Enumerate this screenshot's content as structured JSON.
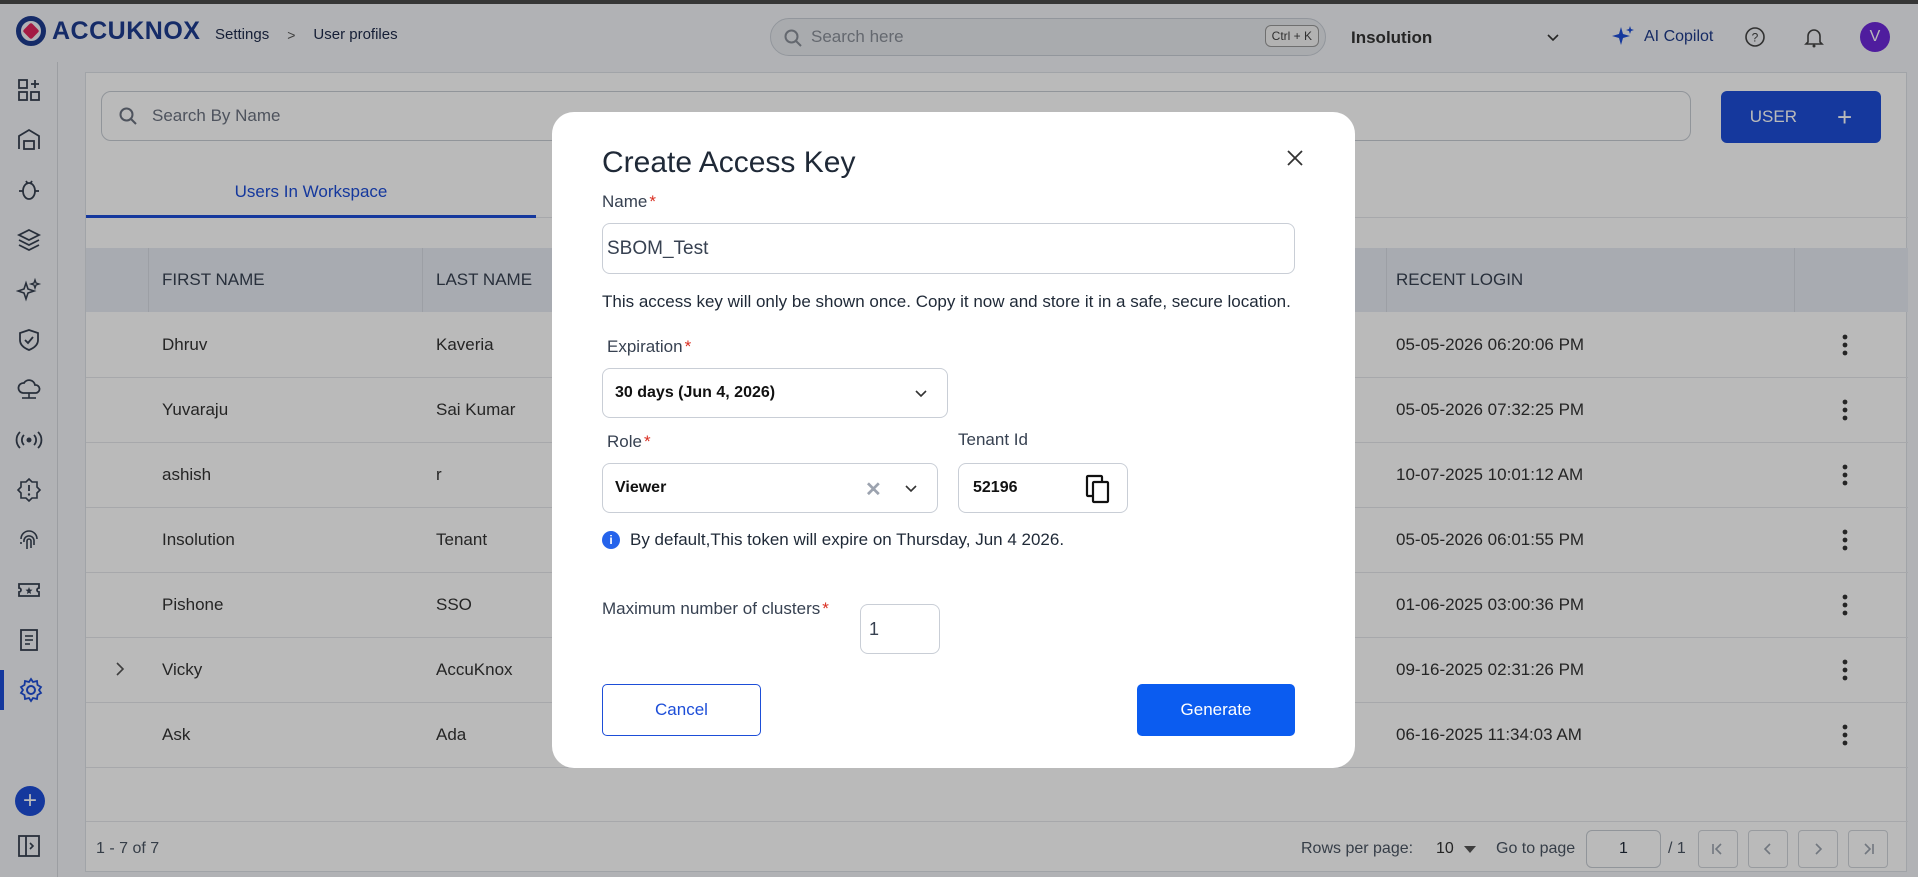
{
  "header": {
    "logo_text": "ACCUKNOX",
    "breadcrumb": [
      "Settings",
      "User profiles"
    ],
    "search_placeholder": "Search here",
    "search_shortcut": "Ctrl + K",
    "tenant": "Insolution",
    "copilot_label": "AI Copilot",
    "avatar_initial": "V"
  },
  "sidebar": {
    "icons": [
      "dashboard-icon",
      "inventory-icon",
      "bug-icon",
      "layers-icon",
      "sparkle-icon",
      "shield-icon",
      "cloud-network-icon",
      "radio-signal-icon",
      "alert-badge-icon",
      "fingerprint-icon",
      "ticket-icon",
      "report-icon",
      "settings-icon"
    ],
    "active": "settings-icon"
  },
  "main": {
    "search_placeholder": "Search By Name",
    "user_button": "USER",
    "tab_label": "Users In Workspace",
    "columns": [
      "FIRST NAME",
      "LAST NAME",
      "RECENT LOGIN"
    ],
    "rows": [
      {
        "first": "Dhruv",
        "last": "Kaveria",
        "login": "05-05-2026 06:20:06 PM"
      },
      {
        "first": "Yuvaraju",
        "last": "Sai Kumar",
        "login": "05-05-2026 07:32:25 PM"
      },
      {
        "first": "ashish",
        "last": "r",
        "login": "10-07-2025 10:01:12 AM"
      },
      {
        "first": "Insolution",
        "last": "Tenant",
        "login": "05-05-2026 06:01:55 PM"
      },
      {
        "first": "Pishone",
        "last": "SSO",
        "login": "01-06-2025 03:00:36 PM"
      },
      {
        "first": "Vicky",
        "last": "AccuKnox",
        "login": "09-16-2025 02:31:26 PM"
      },
      {
        "first": "Ask",
        "last": "Ada",
        "login": "06-16-2025 11:34:03 AM"
      }
    ],
    "footer": {
      "range": "1 - 7 of 7",
      "rows_per_page_label": "Rows per page:",
      "rows_per_page": "10",
      "go_to_page_label": "Go to page",
      "page": "1",
      "total_pages": "/ 1"
    }
  },
  "modal": {
    "title": "Create Access Key",
    "name_label": "Name",
    "name_value": "SBOM_Test",
    "notice": "This access key will only be shown once. Copy it now and store it in a safe, secure location.",
    "expiration_label": "Expiration",
    "expiration_value": "30 days (Jun 4, 2026)",
    "role_label": "Role",
    "role_value": "Viewer",
    "tenant_label": "Tenant Id",
    "tenant_value": "52196",
    "info_text": "By default,This token will expire on Thursday, Jun 4 2026.",
    "clusters_label": "Maximum number of clusters",
    "clusters_value": "1",
    "cancel_label": "Cancel",
    "generate_label": "Generate",
    "required_mark": "*"
  },
  "colors": {
    "primary": "#1d4ed8",
    "button_primary": "#0b5cf0",
    "required": "#d92d20",
    "avatar": "#6d28d9"
  }
}
